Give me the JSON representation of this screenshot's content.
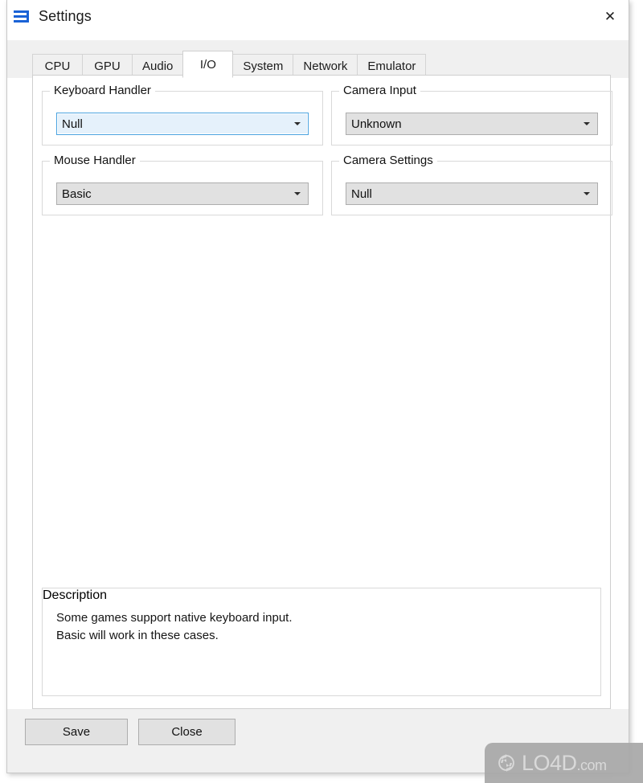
{
  "window": {
    "title": "Settings",
    "app_icon": "stacked-bars-icon",
    "close_icon": "close-icon",
    "close_glyph": "✕"
  },
  "tabs": [
    {
      "label": "CPU",
      "active": false
    },
    {
      "label": "GPU",
      "active": false
    },
    {
      "label": "Audio",
      "active": false
    },
    {
      "label": "I/O",
      "active": true
    },
    {
      "label": "System",
      "active": false
    },
    {
      "label": "Network",
      "active": false
    },
    {
      "label": "Emulator",
      "active": false
    }
  ],
  "groups": {
    "keyboard_handler": {
      "title": "Keyboard Handler",
      "value": "Null",
      "focused": true
    },
    "camera_input": {
      "title": "Camera Input",
      "value": "Unknown",
      "focused": false
    },
    "mouse_handler": {
      "title": "Mouse Handler",
      "value": "Basic",
      "focused": false
    },
    "camera_settings": {
      "title": "Camera Settings",
      "value": "Null",
      "focused": false
    }
  },
  "description": {
    "title": "Description",
    "text": "Some games support native keyboard input.\nBasic will work in these cases."
  },
  "footer": {
    "save_label": "Save",
    "close_label": "Close"
  },
  "watermark": {
    "name": "LO4D",
    "tld": ".com"
  },
  "colors": {
    "accent_blue": "#1a62d6",
    "focus_border": "#4aa3e0",
    "focus_fill": "#e5f1fb",
    "chrome_gray": "#f0f0f0",
    "control_gray": "#e1e1e1",
    "control_border": "#adadad",
    "group_border": "#d9d9d9",
    "watermark_bg": "#a8a8a8"
  }
}
